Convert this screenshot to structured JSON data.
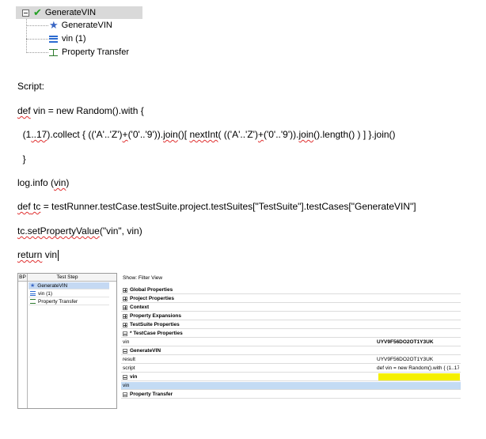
{
  "tree": {
    "root_label": "GenerateVIN",
    "children": [
      "GenerateVIN",
      "vin (1)",
      "Property Transfer"
    ]
  },
  "script": {
    "heading": "Script:",
    "line1_kw": "def",
    "line1_rest": " vin = new Random().with {",
    "line2_a": "  (1",
    "line2_b": "..17",
    "line2_c": ").collect { (('A'..'Z')",
    "line2_d": "+",
    "line2_e": "('0'..'9')).",
    "line2_f": "join",
    "line2_g": "()[ ",
    "line2_h": "nextInt",
    "line2_i": "( (('A'..'Z')",
    "line2_j": "+",
    "line2_k": "('0'..'9')).",
    "line2_l": "join",
    "line2_m": "().length() ) ] }.join()",
    "line3": "  }",
    "line4_a": "log.info (",
    "line4_b": "vin",
    "line4_c": ")",
    "line5_kw": "def",
    "line5_tc": " tc",
    "line5_rest": " = testRunner.testCase.testSuite.project.testSuites[\"TestSuite\"].testCases[\"GenerateVIN\"]",
    "line6_a": "tc.setPropertyValue",
    "line6_b": "(\"vin\", vin)",
    "line7_a": "return",
    "line7_b": " vin"
  },
  "screenshot": {
    "left": {
      "bp_label": "BP",
      "title": "Test Step",
      "steps": [
        "GenerateVIN",
        "vin (1)",
        "Property Transfer"
      ]
    },
    "right": {
      "show_label": "Show:  Filter View",
      "sections": [
        "Global Properties",
        "Project Properties",
        "Context",
        "Property Expansions",
        "TestSuite Properties",
        "* TestCase Properties"
      ],
      "testcase_prop_name": "vin",
      "testcase_prop_value": "UYV9F56DO2OT1Y3UK",
      "generatevin_section": "GenerateVIN",
      "result_label": "result",
      "result_value": "UYV9F56DO2OT1Y3UK",
      "script_label": "script",
      "script_value": "def vin = new Random().with {   (1..17",
      "vin_section": "vin",
      "vin_row_label": "vin",
      "property_transfer_section": "Property Transfer"
    }
  },
  "colors": {
    "tree_selected_bg": "#d9d9d9",
    "check_green": "#22a023",
    "highlight_yellow": "#f5f000",
    "selected_blue": "#c3dbf4"
  }
}
